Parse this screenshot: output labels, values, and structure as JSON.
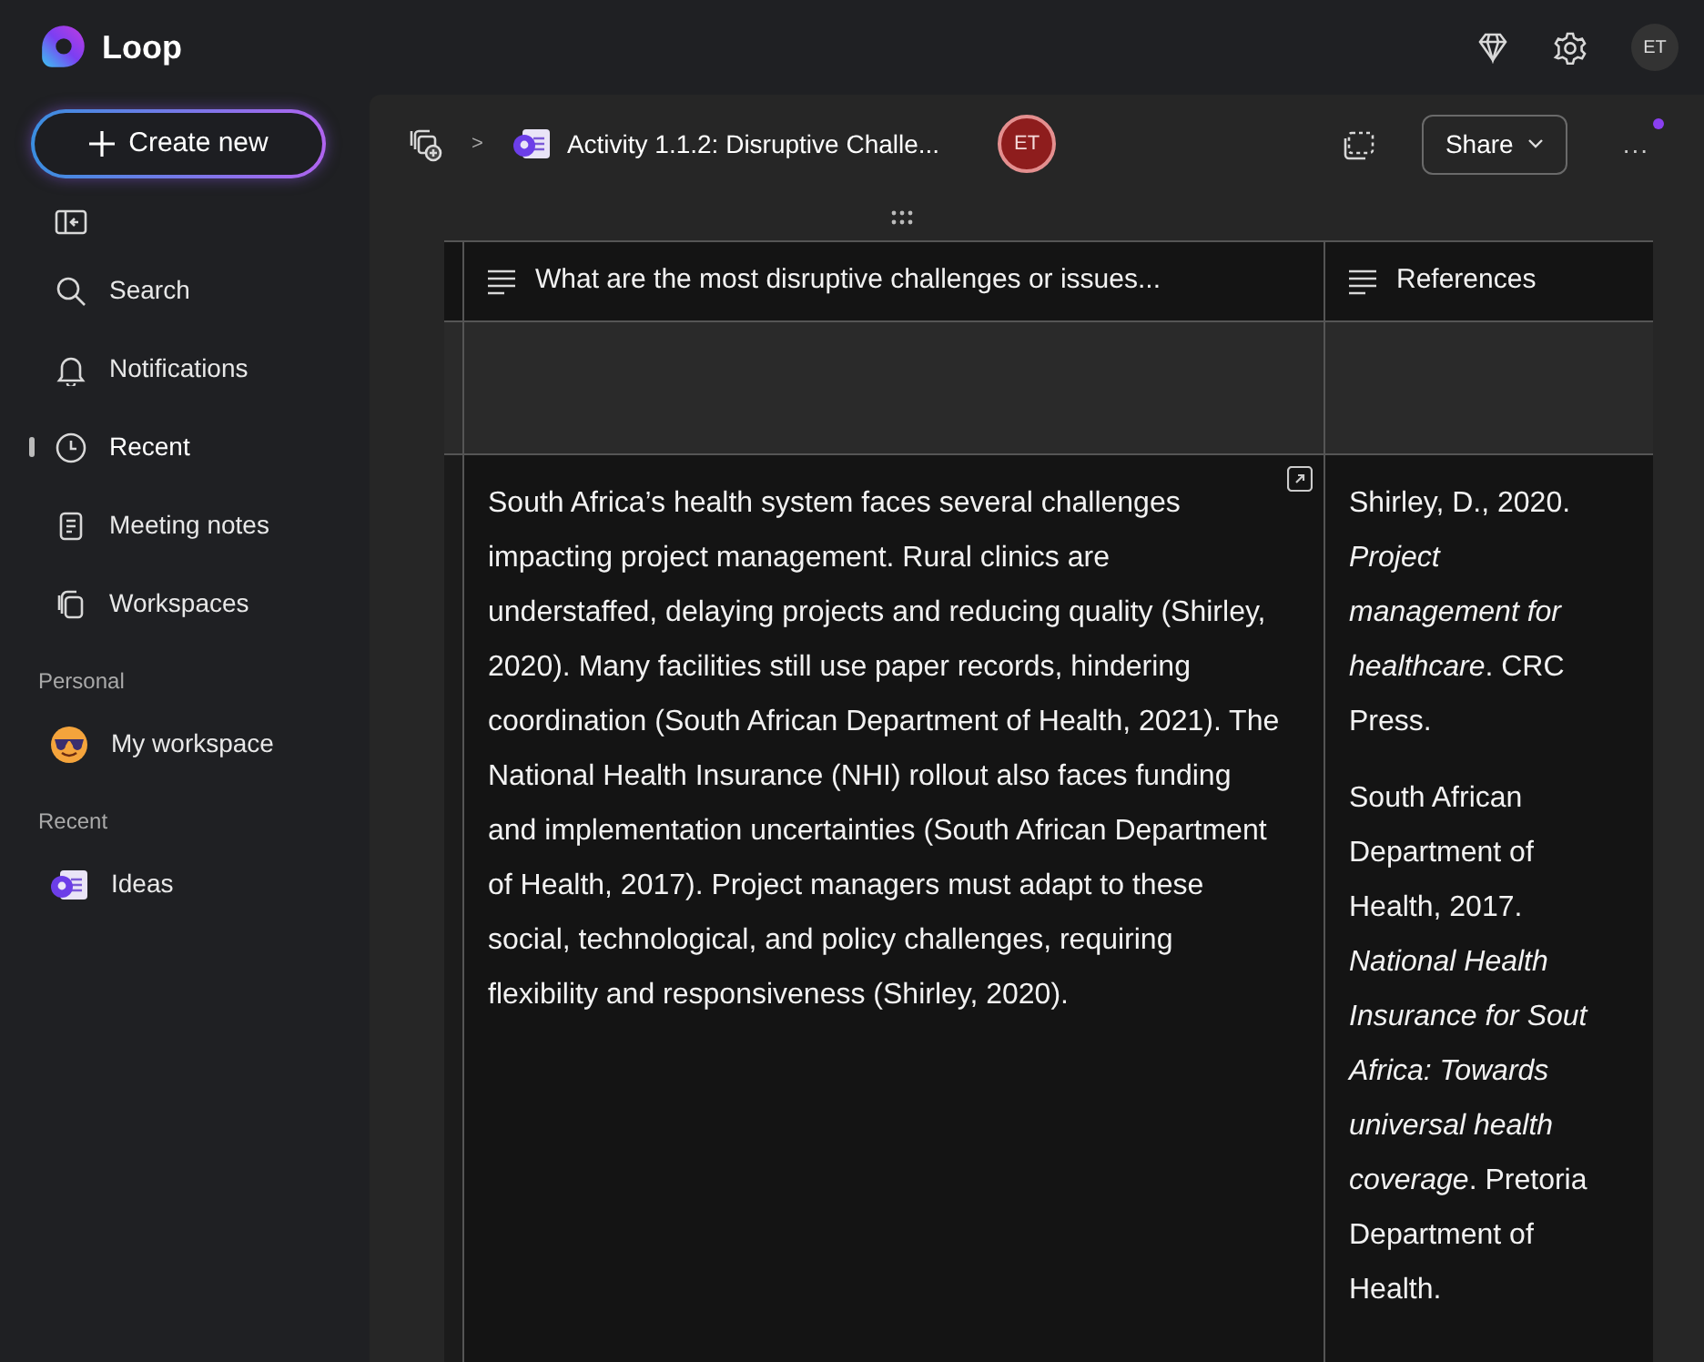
{
  "app": {
    "title": "Loop",
    "avatar": "ET"
  },
  "sidebar": {
    "create_button": "Create new",
    "items": [
      {
        "label": "Search",
        "kind": "search",
        "selected": false
      },
      {
        "label": "Notifications",
        "kind": "bell",
        "selected": false
      },
      {
        "label": "Recent",
        "kind": "clock",
        "selected": true
      },
      {
        "label": "Meeting notes",
        "kind": "notes",
        "selected": false
      },
      {
        "label": "Workspaces",
        "kind": "workspaces",
        "selected": false
      }
    ],
    "sections": [
      {
        "heading": "Personal",
        "items": [
          {
            "label": "My workspace",
            "kind": "emoji"
          }
        ]
      },
      {
        "heading": "Recent",
        "items": [
          {
            "label": "Ideas",
            "kind": "page"
          }
        ]
      }
    ]
  },
  "toolbar": {
    "breadcrumb_separator": ">",
    "page_title": "Activity 1.1.2: Disruptive Challe...",
    "collaborator": "ET",
    "share_button": "Share",
    "more_button": "...",
    "has_notification": true
  },
  "table": {
    "columns": [
      {
        "label": "What are the most disruptive challenges or issues..."
      },
      {
        "label": "References"
      }
    ],
    "rows": [
      {
        "cells": [
          [
            ""
          ],
          [
            ""
          ]
        ]
      },
      {
        "cells": [
          [
            "South Africa’s health system faces several challenges impacting project management. Rural clinics are understaffed, delaying projects and reducing quality (Shirley, 2020). Many facilities still use paper records, hindering coordination (South African Department of Health, 2021). The National Health Insurance (NHI) rollout also faces funding and implementation uncertainties (South African Department of Health, 2017). Project managers must adapt to these social, technological, and policy challenges, requiring flexibility and responsiveness (Shirley, 2020)."
          ],
          [
            [
              "Shirley, D., 2020.",
              "*Project*",
              "*management for*",
              "*healthcare*. CRC",
              "Press."
            ],
            [
              "South African",
              "Department of",
              "Health, 2017.",
              "*National Health*",
              "*Insurance for Sout*",
              "*Africa: Towards*",
              "*universal health*",
              "*coverage*. Pretoria",
              "Department of",
              "Health."
            ]
          ]
        ]
      }
    ]
  }
}
